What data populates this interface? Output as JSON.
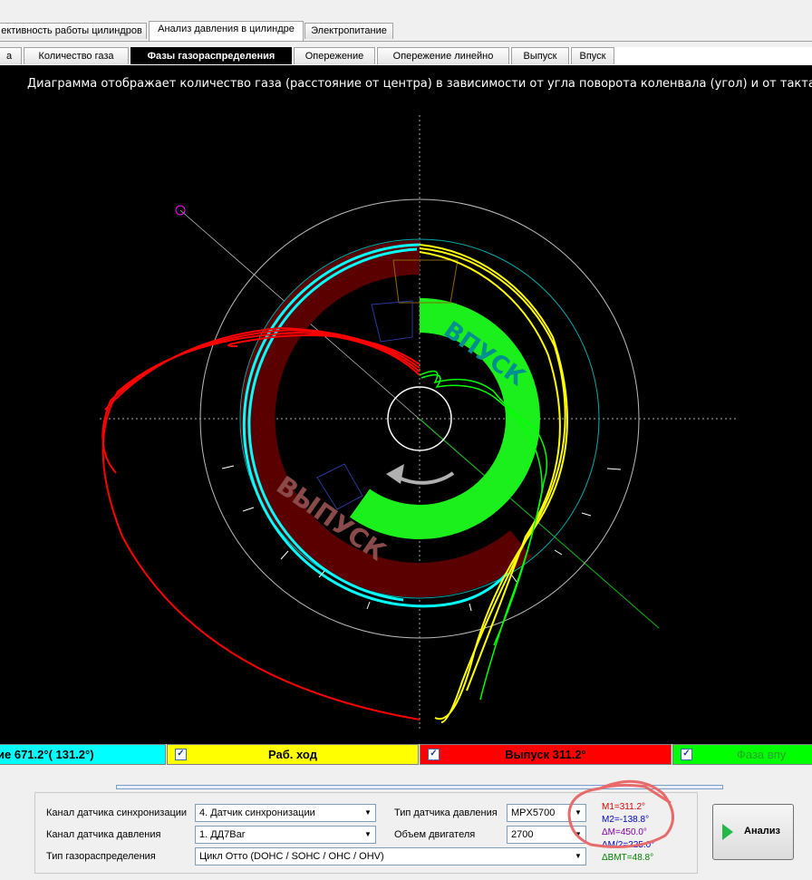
{
  "tabs_main": [
    {
      "label": "ективность работы цилиндров",
      "active": false
    },
    {
      "label": "Анализ давления в цилиндре",
      "active": true
    },
    {
      "label": "Электропитание",
      "active": false
    }
  ],
  "tabs_sub": [
    {
      "label": "а",
      "active": false
    },
    {
      "label": "Количество газа",
      "active": false
    },
    {
      "label": "Фазы газораспределения",
      "active": true
    },
    {
      "label": "Опережение",
      "active": false
    },
    {
      "label": "Опережение линейно",
      "active": false
    },
    {
      "label": "Выпуск",
      "active": false
    },
    {
      "label": "Впуск",
      "active": false
    }
  ],
  "chart": {
    "description": "Диаграмма отображает количество газа (расстояние от центра) в зависимости от угла поворота коленвала (угол) и от такта (цвет)",
    "label_intake": "ВПУСК",
    "label_exhaust": "ВЫПУСК",
    "colors": {
      "compression": "#00ffff",
      "power": "#ffff00",
      "exhaust": "#ff0000",
      "intake": "#00ff00",
      "exhaust_band": "#5a0000",
      "intake_band": "#1cf01c"
    }
  },
  "chart_data": {
    "type": "polar",
    "title": "",
    "series": [
      {
        "name": "Сжатие",
        "color": "#00ffff"
      },
      {
        "name": "Раб. ход",
        "color": "#ffff00"
      },
      {
        "name": "Выпуск",
        "color": "#ff0000"
      },
      {
        "name": "Фаза впуска",
        "color": "#00ff00"
      }
    ]
  },
  "legend": [
    {
      "label": "ие 671.2°( 131.2°)",
      "color": "#00ffff",
      "checkbox": false
    },
    {
      "label": "Раб. ход",
      "color": "#ffff00",
      "checkbox": true
    },
    {
      "label": "Выпуск 311.2°",
      "color": "#ff0000",
      "checkbox": true
    },
    {
      "label": "Фаза впу",
      "color": "#00ff00",
      "checkbox": true
    }
  ],
  "settings": {
    "sync_channel_label": "Канал датчика синхронизации",
    "sync_channel_value": "4.  Датчик синхронизации",
    "pressure_channel_label": "Канал датчика давления",
    "pressure_channel_value": "1.  ДД7Bar",
    "timing_type_label": "Тип газораспределения",
    "timing_type_value": "Цикл Отто (DOHC / SOHC / OHC / OHV)",
    "pressure_sensor_label": "Тип датчика давления",
    "pressure_sensor_value": "MPX5700",
    "engine_volume_label": "Объем двигателя",
    "engine_volume_value": "2700"
  },
  "markers": [
    {
      "text": "M1=311.2°",
      "color": "#e00000"
    },
    {
      "text": "M2=-138.8°",
      "color": "#0000c0"
    },
    {
      "text": "ΔM=450.0°",
      "color": "#8000a0"
    },
    {
      "text": "ΔM/2=225.0°",
      "color": "#0000c0"
    },
    {
      "text": "ΔВМТ=48.8°",
      "color": "#008000"
    }
  ],
  "analyze_button": "Анализ"
}
